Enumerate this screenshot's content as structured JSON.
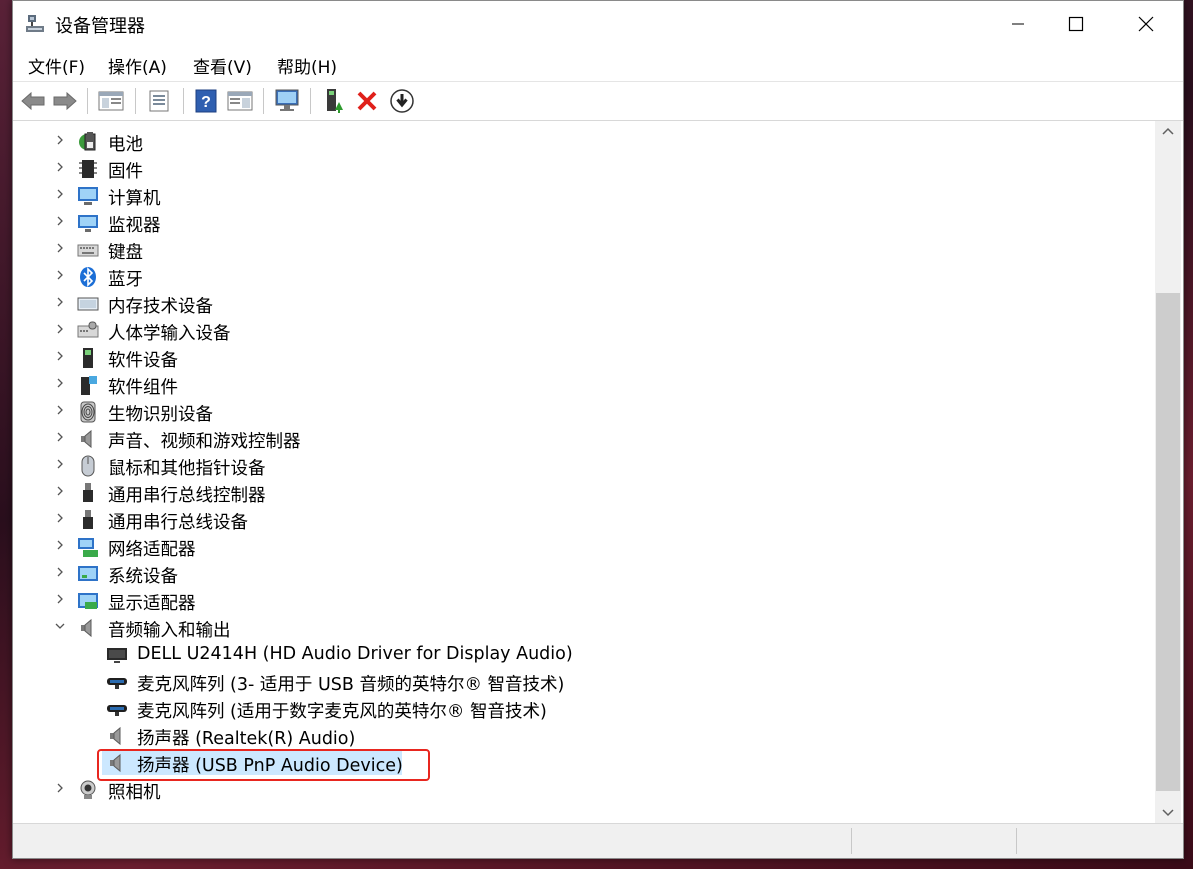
{
  "window": {
    "title": "设备管理器",
    "controls": {
      "minimize": "—",
      "maximize": "☐",
      "close": "✕"
    }
  },
  "menu": [
    {
      "label": "文件(F)"
    },
    {
      "label": "操作(A)"
    },
    {
      "label": "查看(V)"
    },
    {
      "label": "帮助(H)"
    }
  ],
  "toolbar": {
    "buttons": [
      {
        "icon": "back-arrow-icon"
      },
      {
        "icon": "forward-arrow-icon"
      },
      {
        "icon": "show-hide-console-tree-icon"
      },
      {
        "icon": "properties-icon"
      },
      {
        "icon": "help-icon"
      },
      {
        "icon": "action-pane-icon"
      },
      {
        "icon": "scan-hardware-changes-icon"
      },
      {
        "icon": "update-driver-icon"
      },
      {
        "icon": "uninstall-device-icon"
      },
      {
        "icon": "disable-device-icon"
      }
    ]
  },
  "tree": {
    "categories": [
      {
        "label": "电池",
        "icon": "battery-icon",
        "expanded": false
      },
      {
        "label": "固件",
        "icon": "firmware-chip-icon",
        "expanded": false
      },
      {
        "label": "计算机",
        "icon": "computer-icon",
        "expanded": false
      },
      {
        "label": "监视器",
        "icon": "monitor-icon",
        "expanded": false
      },
      {
        "label": "键盘",
        "icon": "keyboard-icon",
        "expanded": false
      },
      {
        "label": "蓝牙",
        "icon": "bluetooth-icon",
        "expanded": false
      },
      {
        "label": "内存技术设备",
        "icon": "memory-device-icon",
        "expanded": false
      },
      {
        "label": "人体学输入设备",
        "icon": "hid-icon",
        "expanded": false
      },
      {
        "label": "软件设备",
        "icon": "software-device-icon",
        "expanded": false
      },
      {
        "label": "软件组件",
        "icon": "software-component-icon",
        "expanded": false
      },
      {
        "label": "生物识别设备",
        "icon": "fingerprint-icon",
        "expanded": false
      },
      {
        "label": "声音、视频和游戏控制器",
        "icon": "speaker-icon",
        "expanded": false
      },
      {
        "label": "鼠标和其他指针设备",
        "icon": "mouse-icon",
        "expanded": false
      },
      {
        "label": "通用串行总线控制器",
        "icon": "usb-icon",
        "expanded": false
      },
      {
        "label": "通用串行总线设备",
        "icon": "usb-icon",
        "expanded": false
      },
      {
        "label": "网络适配器",
        "icon": "network-adapter-icon",
        "expanded": false
      },
      {
        "label": "系统设备",
        "icon": "system-device-icon",
        "expanded": false
      },
      {
        "label": "显示适配器",
        "icon": "display-adapter-icon",
        "expanded": false
      },
      {
        "label": "音频输入和输出",
        "icon": "speaker-icon",
        "expanded": true
      }
    ],
    "audio_children": [
      {
        "label": "DELL U2414H (HD Audio Driver for Display Audio)",
        "icon": "monitor-dark-icon"
      },
      {
        "label": "麦克风阵列 (3- 适用于 USB 音频的英特尔® 智音技术)",
        "icon": "microphone-array-icon"
      },
      {
        "label": "麦克风阵列 (适用于数字麦克风的英特尔® 智音技术)",
        "icon": "microphone-array-icon"
      },
      {
        "label": "扬声器 (Realtek(R) Audio)",
        "icon": "speaker-icon"
      },
      {
        "label": "扬声器 (USB PnP Audio Device)",
        "icon": "speaker-icon",
        "selected": true
      }
    ],
    "last": {
      "label": "照相机",
      "icon": "camera-icon",
      "expanded": false
    }
  },
  "colors": {
    "selection": "#cce8ff",
    "highlight_box": "#e8261f"
  }
}
